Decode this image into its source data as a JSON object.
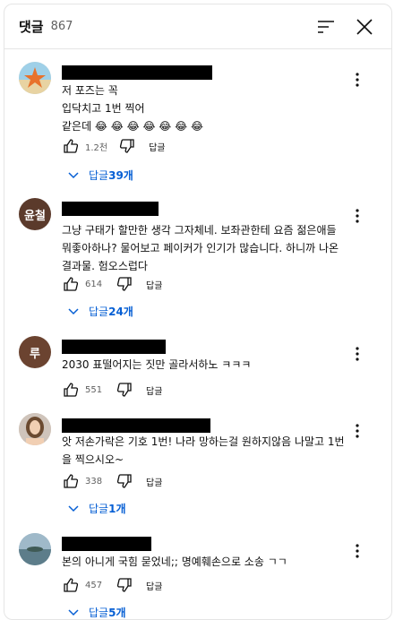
{
  "header": {
    "title": "댓글",
    "count": "867"
  },
  "comments": [
    {
      "text": "저 포즈는 꼭\n입닥치고 1번 찍어\n같은데 😂 😂 😂 😂 😂 😂 😂",
      "likes": "1.2천",
      "reply_label": "답글",
      "replies_prefix": "답글 ",
      "replies_count": "39개"
    },
    {
      "avatar_initials": "윤철",
      "text": "그냥 구태가 할만한 생각 그자체네. 보좌관한테 요즘 젊은애들 뭐좋아하나? 물어보고 페이커가 인기가 많습니다. 하니까 나온 결과물. 험오스럽다",
      "likes": "614",
      "reply_label": "답글",
      "replies_prefix": "답글 ",
      "replies_count": "24개"
    },
    {
      "avatar_initials": "루",
      "text": "2030 표떨어지는 짓만 골라서하노 ㅋㅋㅋ",
      "likes": "551",
      "reply_label": "답글"
    },
    {
      "text": "앗 저손가락은 기호 1번! 나라 망하는걸 원하지않음 나말고 1번을 찍으시오~",
      "likes": "338",
      "reply_label": "답글",
      "replies_prefix": "답글 ",
      "replies_count": "1개"
    },
    {
      "text": "본의 아니게 국힘 묻었네;; 명예훼손으로 소송 ㄱㄱ",
      "likes": "457",
      "reply_label": "답글",
      "replies_prefix": "답글 ",
      "replies_count": "5개"
    }
  ],
  "colors": {
    "link": "#065fd4",
    "avatar_2": "#5b3a2b",
    "avatar_3": "#6b4330"
  }
}
